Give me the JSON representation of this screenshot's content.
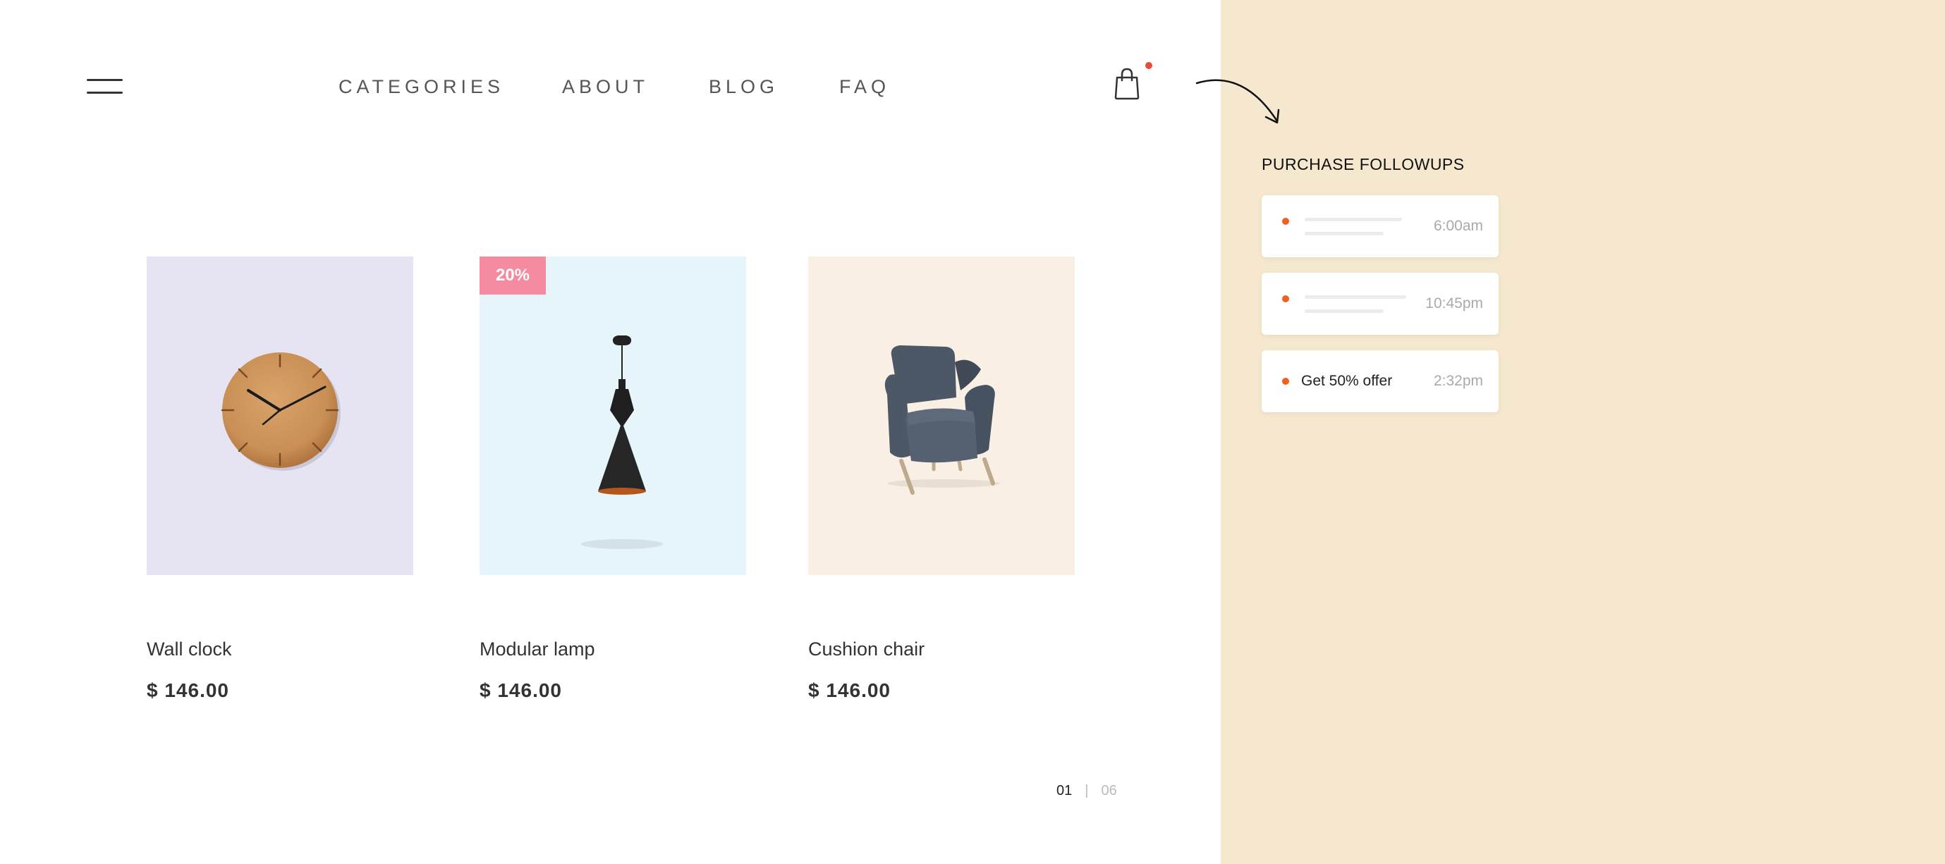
{
  "header": {
    "nav": [
      {
        "label": "CATEGORIES"
      },
      {
        "label": "ABOUT"
      },
      {
        "label": "BLOG"
      },
      {
        "label": "FAQ"
      }
    ],
    "cart_has_notification": true
  },
  "products": [
    {
      "name": "Wall clock",
      "price": "$ 146.00",
      "tile_color": "#e6e4f3"
    },
    {
      "name": "Modular lamp",
      "price": "$ 146.00",
      "badge": "20%",
      "tile_color": "#e6f5fa"
    },
    {
      "name": "Cushion chair",
      "price": "$ 146.00",
      "tile_color": "#f9efe5"
    }
  ],
  "pagination": {
    "current": "01",
    "separator": "|",
    "total": "06"
  },
  "followups": {
    "title": "PURCHASE FOLLOWUPS",
    "items": [
      {
        "text": "",
        "time": "6:00am"
      },
      {
        "text": "",
        "time": "10:45pm"
      },
      {
        "text": "Get 50% offer",
        "time": "2:32pm"
      }
    ]
  },
  "colors": {
    "accent_dot": "#f06022",
    "badge": "#f58ba0",
    "panel": "#f5e8ce"
  }
}
